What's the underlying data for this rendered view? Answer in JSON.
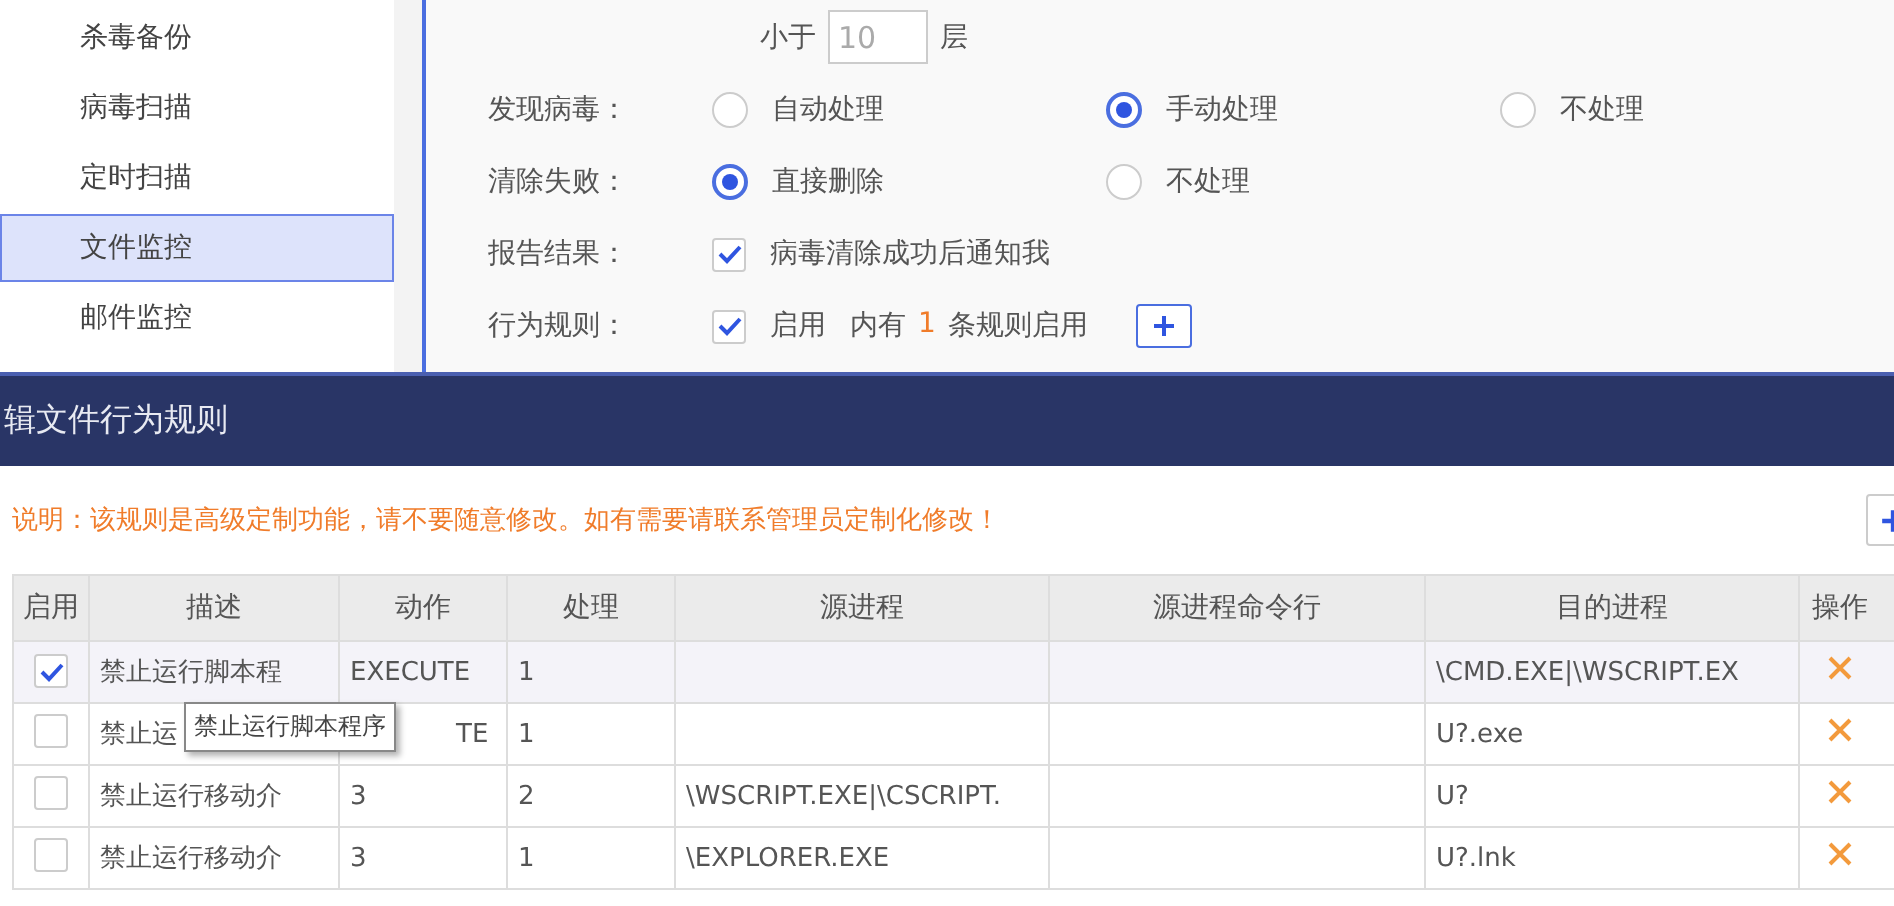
{
  "sidebar": {
    "items": [
      {
        "label": "杀毒备份",
        "selected": false
      },
      {
        "label": "病毒扫描",
        "selected": false
      },
      {
        "label": "定时扫描",
        "selected": false
      },
      {
        "label": "文件监控",
        "selected": true
      },
      {
        "label": "邮件监控",
        "selected": false
      }
    ]
  },
  "settings": {
    "layers": {
      "prefix": "小于",
      "value": "10",
      "suffix": "层"
    },
    "rows": [
      {
        "kind": "radio",
        "label": "发现病毒：",
        "options": [
          {
            "label": "自动处理",
            "selected": false
          },
          {
            "label": "手动处理",
            "selected": true
          },
          {
            "label": "不处理",
            "selected": false
          }
        ]
      },
      {
        "kind": "radio",
        "label": "清除失败：",
        "options": [
          {
            "label": "直接删除",
            "selected": true
          },
          {
            "label": "不处理",
            "selected": false
          }
        ]
      },
      {
        "kind": "checkbox",
        "label": "报告结果：",
        "checked": true,
        "text": "病毒清除成功后通知我"
      },
      {
        "kind": "rule",
        "label": "行为规则：",
        "checked": true,
        "text": "启用",
        "count_prefix": "内有",
        "count": "1",
        "count_suffix": "条规则启用"
      }
    ]
  },
  "dialog": {
    "title": "辑文件行为规则",
    "notice": "说明：该规则是高级定制功能，请不要随意修改。如有需要请联系管理员定制化修改！",
    "columns": [
      "启用",
      "描述",
      "动作",
      "处理",
      "源进程",
      "源进程命令行",
      "目的进程",
      "操作"
    ],
    "rows": [
      {
        "enabled": true,
        "selected": true,
        "cells": [
          "",
          "禁止运行脚本程",
          "EXECUTE",
          "1",
          "",
          "",
          "\\CMD.EXE|\\WSCRIPT.EX",
          ""
        ]
      },
      {
        "enabled": false,
        "selected": false,
        "tooltip": "禁止运行脚本程序",
        "cells": [
          "",
          "禁止运",
          "TE",
          "1",
          "",
          "",
          "U?.exe",
          ""
        ]
      },
      {
        "enabled": false,
        "selected": false,
        "cells": [
          "",
          "禁止运行移动介",
          "3",
          "2",
          "\\WSCRIPT.EXE|\\CSCRIPT.",
          "",
          "U?",
          ""
        ]
      },
      {
        "enabled": false,
        "selected": false,
        "cells": [
          "",
          "禁止运行移动介",
          "3",
          "1",
          "\\EXPLORER.EXE",
          "",
          "U?.lnk",
          ""
        ]
      }
    ]
  }
}
